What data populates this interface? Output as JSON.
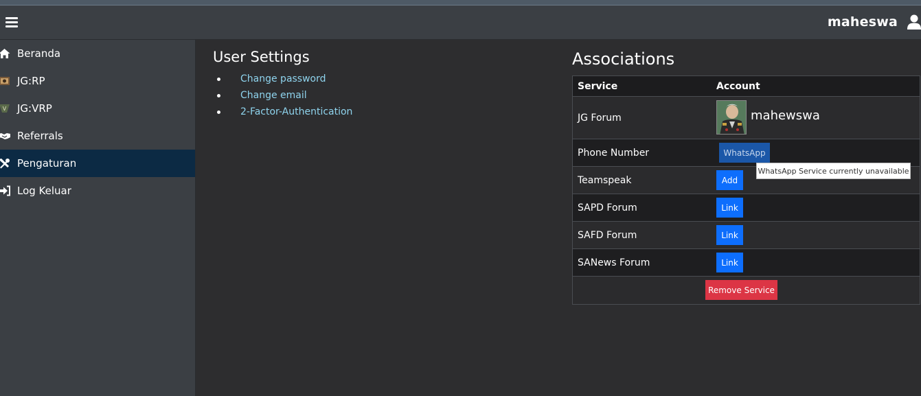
{
  "header": {
    "username": "maheswa"
  },
  "sidebar": {
    "items": [
      {
        "label": "Beranda",
        "icon": "home-icon"
      },
      {
        "label": "JG:RP",
        "icon": "jgrp-logo-icon"
      },
      {
        "label": "JG:VRP",
        "icon": "jgvrp-logo-icon"
      },
      {
        "label": "Referrals",
        "icon": "handshake-icon"
      },
      {
        "label": "Pengaturan",
        "icon": "tools-icon",
        "active": true
      },
      {
        "label": "Log Keluar",
        "icon": "sign-out-icon"
      }
    ]
  },
  "user_settings": {
    "title": "User Settings",
    "links": [
      "Change password",
      "Change email",
      "2-Factor-Authentication"
    ]
  },
  "associations": {
    "title": "Associations",
    "headers": {
      "service": "Service",
      "account": "Account"
    },
    "rows": [
      {
        "service": "JG Forum",
        "account_name": "mahewswa"
      },
      {
        "service": "Phone Number",
        "button": "WhatsApp"
      },
      {
        "service": "Teamspeak",
        "button": "Add"
      },
      {
        "service": "SAPD Forum",
        "button": "Link"
      },
      {
        "service": "SAFD Forum",
        "button": "Link"
      },
      {
        "service": "SANews Forum",
        "button": "Link"
      }
    ],
    "remove_button": "Remove Service",
    "tooltip": "WhatsApp Service currently unavailable"
  },
  "colors": {
    "active_nav": "#0c2a44",
    "link": "#8fd4ee",
    "primary_button": "#0d6efd",
    "danger_button": "#dc3545"
  }
}
